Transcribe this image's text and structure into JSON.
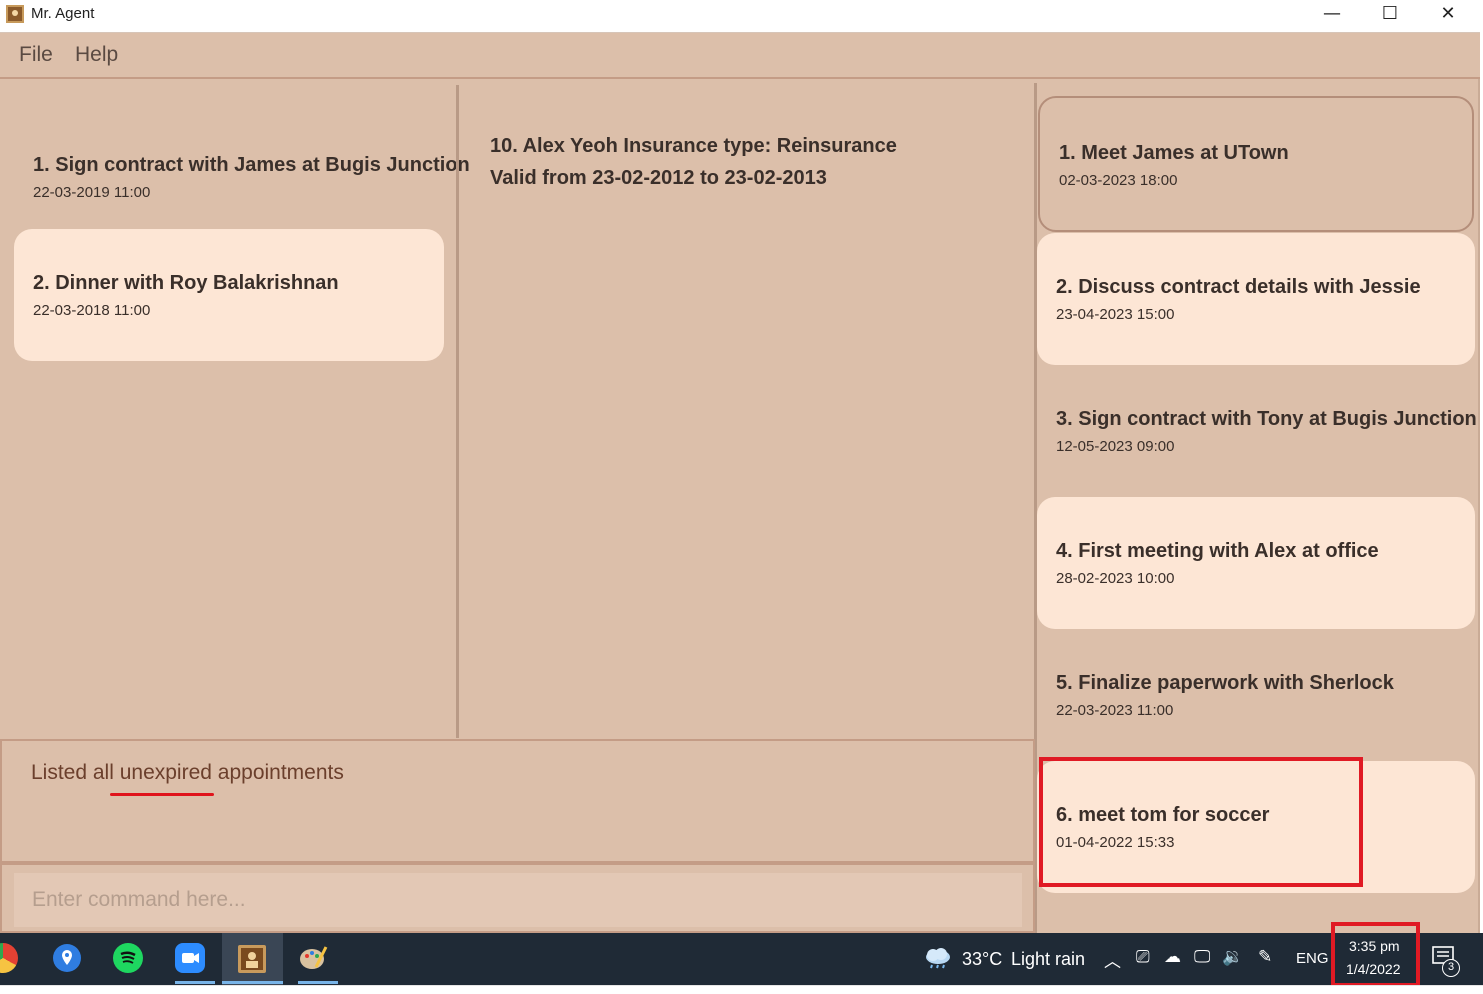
{
  "window": {
    "title": "Mr. Agent",
    "minimize": "—",
    "maximize": "☐",
    "close": "✕"
  },
  "menu": {
    "file": "File",
    "help": "Help"
  },
  "events": [
    {
      "title": "1. Sign contract with James at Bugis Junction",
      "date": "22-03-2019 11:00"
    },
    {
      "title": "2. Dinner with Roy Balakrishnan",
      "date": "22-03-2018 11:00"
    }
  ],
  "client": {
    "line1": "10. Alex Yeoh  Insurance type: Reinsurance",
    "line2": "Valid from 23-02-2012 to 23-02-2013"
  },
  "appointments": [
    {
      "title": "1. Meet James at UTown",
      "date": "02-03-2023 18:00"
    },
    {
      "title": "2. Discuss contract details with Jessie",
      "date": "23-04-2023 15:00"
    },
    {
      "title": "3. Sign contract with Tony at Bugis Junction",
      "date": "12-05-2023 09:00"
    },
    {
      "title": "4. First meeting with Alex at office",
      "date": "28-02-2023 10:00"
    },
    {
      "title": "5. Finalize paperwork with Sherlock",
      "date": "22-03-2023 11:00"
    },
    {
      "title": "6. meet tom for soccer",
      "date": "01-04-2022 15:33"
    }
  ],
  "result": {
    "message": "Listed all unexpired appointments"
  },
  "command": {
    "placeholder": "Enter command here..."
  },
  "taskbar": {
    "weather_temp": "33°C",
    "weather_desc": "Light rain",
    "language": "ENG",
    "time": "3:35 pm",
    "date": "1/4/2022",
    "notification_count": "3"
  },
  "colors": {
    "background": "#dcbfaa",
    "card_highlight": "#fde6d5",
    "annotation_red": "#e01a24",
    "taskbar": "#1f2a36"
  }
}
